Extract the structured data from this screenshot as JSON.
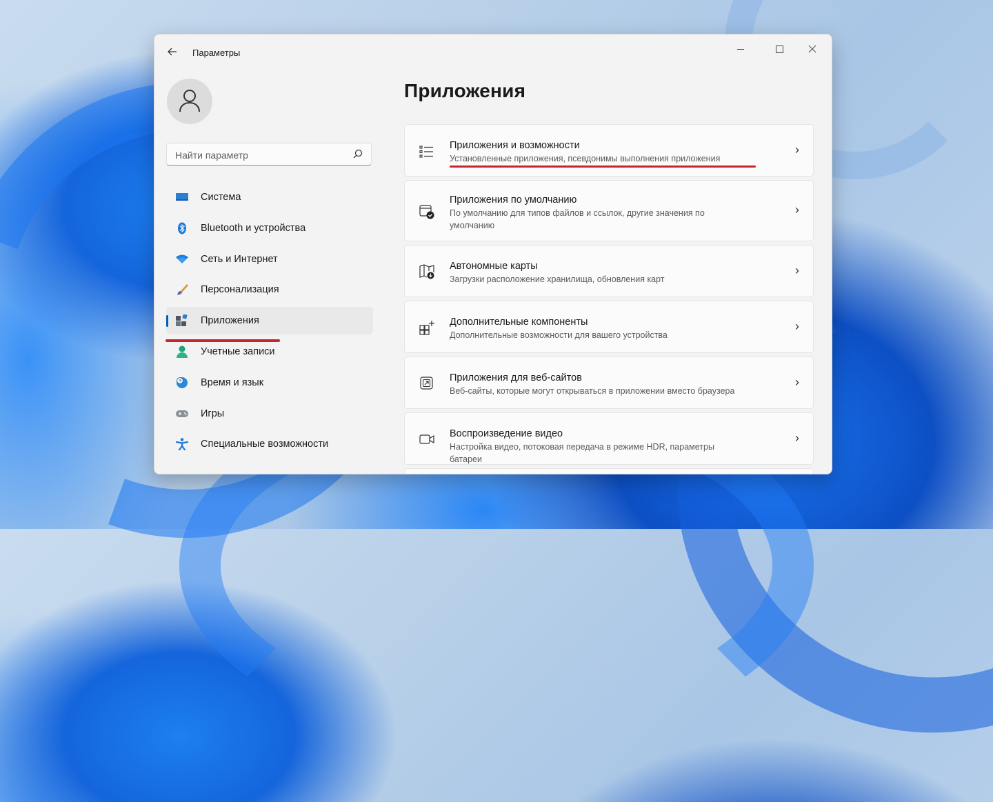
{
  "window": {
    "title": "Параметры"
  },
  "search": {
    "placeholder": "Найти параметр"
  },
  "sidebar": {
    "items": [
      {
        "label": "Система",
        "icon": "monitor-icon"
      },
      {
        "label": "Bluetooth и устройства",
        "icon": "bluetooth-icon"
      },
      {
        "label": "Сеть и Интернет",
        "icon": "wifi-icon"
      },
      {
        "label": "Персонализация",
        "icon": "brush-icon"
      },
      {
        "label": "Приложения",
        "icon": "apps-icon",
        "active": true
      },
      {
        "label": "Учетные записи",
        "icon": "person-icon"
      },
      {
        "label": "Время и язык",
        "icon": "clock-globe-icon"
      },
      {
        "label": "Игры",
        "icon": "gamepad-icon"
      },
      {
        "label": "Специальные возможности",
        "icon": "accessibility-icon"
      }
    ]
  },
  "main": {
    "title": "Приложения",
    "cards": [
      {
        "title": "Приложения и возможности",
        "subtitle": "Установленные приложения, псевдонимы выполнения приложения",
        "icon": "list-icon"
      },
      {
        "title": "Приложения по умолчанию",
        "subtitle": "По умолчанию для типов файлов и ссылок, другие значения по умолчанию",
        "icon": "default-apps-icon"
      },
      {
        "title": "Автономные карты",
        "subtitle": "Загрузки расположение хранилища, обновления карт",
        "icon": "map-download-icon"
      },
      {
        "title": "Дополнительные компоненты",
        "subtitle": "Дополнительные возможности для вашего устройства",
        "icon": "add-components-icon"
      },
      {
        "title": "Приложения для веб-сайтов",
        "subtitle": "Веб-сайты, которые могут открываться в приложении вместо браузера",
        "icon": "open-link-icon"
      },
      {
        "title": "Воспроизведение видео",
        "subtitle": "Настройка видео, потоковая передача в режиме HDR, параметры батареи",
        "icon": "video-icon"
      }
    ]
  },
  "colors": {
    "accent": "#005fb8",
    "annotation": "#c4262e",
    "window_bg": "#f3f3f3",
    "card_bg": "#fbfbfb"
  }
}
